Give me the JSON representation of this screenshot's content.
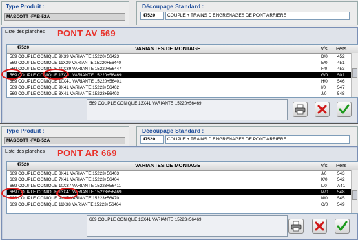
{
  "panel1": {
    "type_label": "Type Produit :",
    "type_value": "MASCOTT -FAB-52A",
    "decoupage_label": "Découpage Standard :",
    "code": "47520",
    "description": "COUPLE + TRAINS D ENGRENAGES DE PONT ARRIERE",
    "window_title": "Liste des planches",
    "highlight_label": "PONT AV 569",
    "list_code": "47520",
    "col_title": "VARIANTES DE MONTAGE",
    "col_vs": "v/s",
    "col_pers": "Pers",
    "rows": [
      {
        "text": "569 COUPLE CONIQUE 9X39 VARIANTE 15220+56423",
        "vs": "D/0",
        "pers": "452"
      },
      {
        "text": "569 COUPLE CONIQUE 11X39 VARIANTE 15220+56440",
        "vs": "E/0",
        "pers": "451"
      },
      {
        "text": "569 COUPLE CONIQUE 10X39 VARIANTE 15220+56447",
        "vs": "F/0",
        "pers": "453"
      },
      {
        "text": "569 COUPLE CONIQUE 13X41 VARIANTE 15220+56469",
        "vs": "G/0",
        "pers": "501"
      },
      {
        "text": "569 COUPLE CONIQUE 10X41 VARIANTE 15220+56401",
        "vs": "H/0",
        "pers": "546"
      },
      {
        "text": "569 COUPLE CONIQUE 9X41 VARIANTE 15223+56402",
        "vs": "I/0",
        "pers": "547"
      },
      {
        "text": "569 COUPLE CONIQUE 8X41 VARIANTE 15223+56403",
        "vs": "J/0",
        "pers": "548"
      }
    ],
    "selected_index": 3,
    "memo_text": "569 COUPLE CONIQUE 13X41 VARIANTE 15220+56469"
  },
  "panel2": {
    "type_label": "Type Produit :",
    "type_value": "MASCOTT -FAB-52A",
    "decoupage_label": "Découpage Standard :",
    "code": "47520",
    "description": "COUPLE + TRAINS D ENGRENAGES DE PONT ARRIERE",
    "window_title": "Liste des planches",
    "highlight_label": "PONT AR 669",
    "list_code": "47520",
    "col_title": "VARIANTES DE MONTAGE",
    "col_vs": "v/s",
    "col_pers": "Pers",
    "rows": [
      {
        "text": "669 COUPLE CONIQUE 8X41 VARIANTE 15223+56403",
        "vs": "J/0",
        "pers": "543"
      },
      {
        "text": "669 COUPLE CONIQUE 7X41 VARIANTE 15223+56404",
        "vs": "K/0",
        "pers": "542"
      },
      {
        "text": "669 COUPLE CONIQUE 10X37 VARIANTE 15223+56411",
        "vs": "L/0",
        "pers": "A41"
      },
      {
        "text": "669 COUPLE CONIQUE 13X41 VARIANTE 15223+56469",
        "vs": "M/0",
        "pers": "548"
      },
      {
        "text": "669 COUPLE CONIQUE 9X37 VARIANTE 15223+56470",
        "vs": "N/0",
        "pers": "545"
      },
      {
        "text": "669 COUPLE CONIQUE 11X38 VARIANTE 15223+56464",
        "vs": "O/0",
        "pers": "549"
      }
    ],
    "selected_index": 3,
    "memo_text": "669 COUPLE CONIQUE 13X41 VARIANTE 15223+56469"
  },
  "icons": {
    "print": "printer-icon",
    "cancel": "red-x-icon",
    "validate": "green-check-icon"
  },
  "colors": {
    "title_blue": "#1e4d9a",
    "highlight_red": "#e8312a",
    "selection": "#000000"
  }
}
